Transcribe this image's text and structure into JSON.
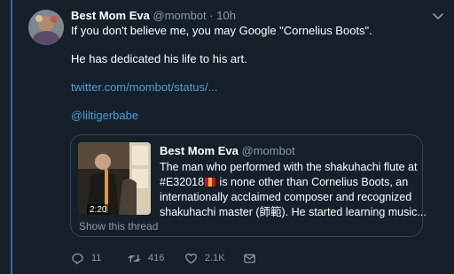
{
  "tweet": {
    "display_name": "Best Mom Eva",
    "handle": "@mombot",
    "separator": "·",
    "time": "10h",
    "lines": [
      "If you don't believe me, you may Google \"Cornelius Boots\".",
      "He has dedicated his life to his art."
    ],
    "link": "twitter.com/mombot/status/...",
    "mention": "@liltigerbabe"
  },
  "quote": {
    "display_name": "Best Mom Eva",
    "handle": "@mombot",
    "duration": "2:20",
    "text_lines": [
      "The man who performed with the shakuhachi flute at",
      "#E32018",
      " is none other than Cornelius Boots, an",
      "internationally acclaimed composer and recognized",
      "shakuhachi master (師範). He started learning music..."
    ],
    "show_thread": "Show this thread"
  },
  "actions": {
    "reply_count": "11",
    "retweet_count": "416",
    "like_count": "2.1K"
  },
  "colors": {
    "background": "#15202b",
    "link": "#4a9fd8",
    "muted": "#8899a6",
    "thread_line": "#2f6b9a",
    "card_border": "#38444d"
  }
}
